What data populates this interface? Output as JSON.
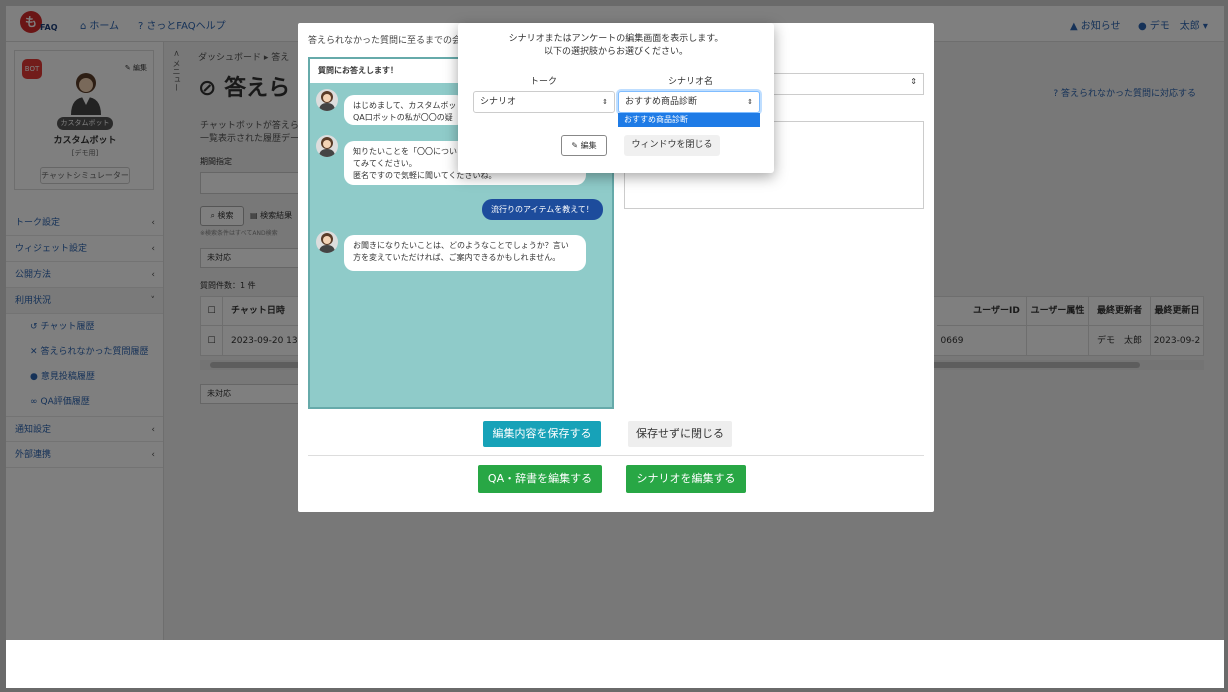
{
  "topbar": {
    "logo_text": "FAQ",
    "logo_mark": "も",
    "home": "ホーム",
    "help": "さっとFAQヘルプ",
    "notice": "お知らせ",
    "user": "デモ　太郎"
  },
  "profile": {
    "badge": "BOT",
    "edit": "編集",
    "tag": "カスタムボット",
    "name": "カスタムボット",
    "sub": "[デモ用]",
    "simulator": "チャットシミュレーター"
  },
  "sidebar": {
    "items": [
      {
        "label": "トーク設定"
      },
      {
        "label": "ウィジェット設定"
      },
      {
        "label": "公開方法"
      },
      {
        "label": "利用状況"
      },
      {
        "label": "通知設定"
      },
      {
        "label": "外部連携"
      }
    ],
    "subitems": [
      {
        "label": "チャット履歴"
      },
      {
        "label": "答えられなかった質問履歴"
      },
      {
        "label": "意見投稿履歴"
      },
      {
        "label": "QA評価履歴"
      }
    ]
  },
  "page": {
    "collapse": "< メニュー",
    "breadcrumb": "ダッシュボード  ▸  答え",
    "title": "答えら",
    "help_link": "答えられなかった質問に対応する",
    "desc_line1": "チャットボットが答えら",
    "desc_line2": "一覧表示された履歴デー",
    "period_label": "期間指定",
    "search": "検索",
    "export": "検索結果",
    "note": "※検索条件はすべてAND検索",
    "filter1": "未対応",
    "filter2": "未対応",
    "count": "質問件数：1 件"
  },
  "table": {
    "headers": {
      "date": "チャット日時",
      "user_id": "ユーザーID",
      "user_attr": "ユーザー属性",
      "updater": "最終更新者",
      "updated": "最終更新日"
    },
    "row": {
      "date": "2023-09-20 13:5",
      "id_tail": "0669",
      "updater": "デモ　太郎",
      "updated": "2023-09-2"
    }
  },
  "modal": {
    "heading": "答えられなかった質問に至るまでの会",
    "chat_header": "質問にお答えします！",
    "messages": [
      {
        "line1": "はじめまして、カスタムボッ",
        "line2": "QA口ボットの私が〇〇の疑"
      },
      {
        "line1": "知りたいことを「〇〇につい",
        "line2": "てみてください。",
        "line3": "匿名ですので気軽に聞いてくださいね。"
      },
      {
        "line1": "お聞きになりたいことは、どのようなことでしょうか？言い",
        "line2": "方を変えていただければ、ご案内できるかもしれません。"
      }
    ],
    "user_message": "流行りのアイテムを教えて！",
    "save_edit": "編集内容を保存する",
    "close_nosave": "保存せずに閉じる",
    "qa_edit": "QA・辞書を編集する",
    "scenario_edit": "シナリオを編集する"
  },
  "popup": {
    "msg_line1": "シナリオまたはアンケートの編集画面を表示します。",
    "msg_line2": "以下の選択肢からお選びください。",
    "talk_label": "トーク",
    "scenario_label": "シナリオ名",
    "talk_value": "シナリオ",
    "scenario_value": "おすすめ商品診断",
    "option_highlighted": "おすすめ商品診断",
    "edit": "編集",
    "close": "ウィンドウを閉じる"
  },
  "colors": {
    "primary": "#2c64b0",
    "success": "#28a745",
    "info": "#17a2b8",
    "chat_bg": "#8fcbc9",
    "user_bubble": "#1d4c9c",
    "dropdown_highlight": "#1e7be6"
  }
}
